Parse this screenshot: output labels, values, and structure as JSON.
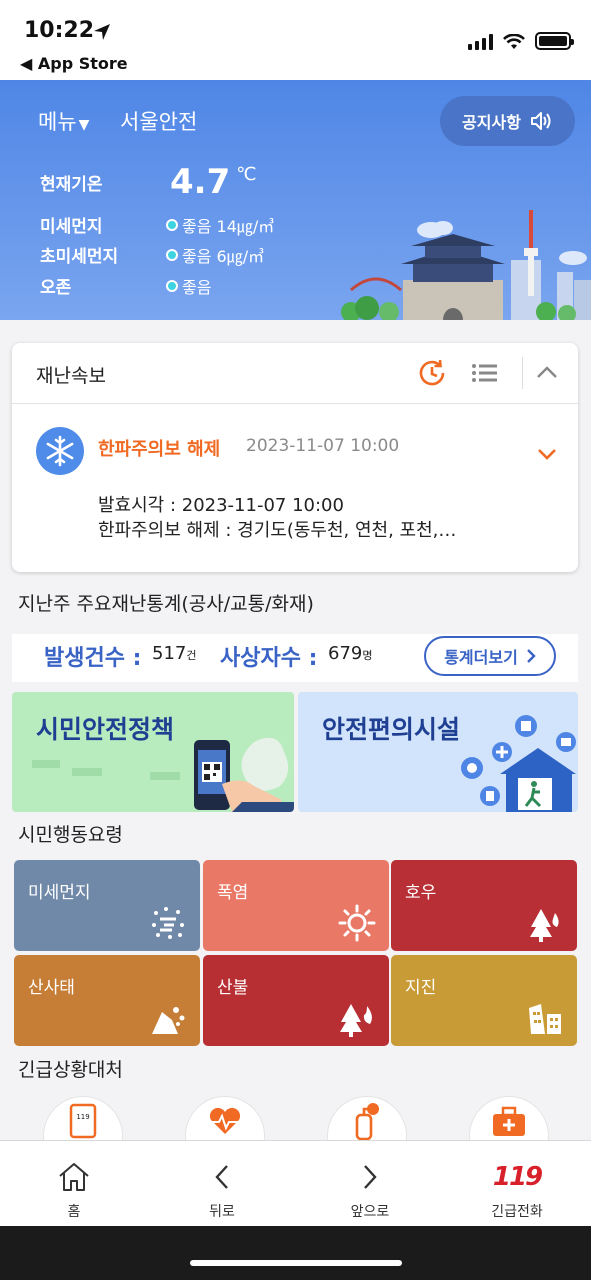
{
  "status_bar": {
    "time": "10:22",
    "back_app": "◀ App Store"
  },
  "header": {
    "menu_label": "메뉴",
    "city": "서울안전",
    "notice_label": "공지사항"
  },
  "weather": {
    "temp_label": "현재기온",
    "temp_value": "4.7",
    "temp_unit": "℃",
    "rows": [
      {
        "label": "미세먼지",
        "value": "좋음 14㎍/㎥"
      },
      {
        "label": "초미세먼지",
        "value": "좋음 6㎍/㎥"
      },
      {
        "label": "오존",
        "value": "좋음"
      }
    ]
  },
  "disaster_card": {
    "title": "재난속보",
    "alert_title": "한파주의보 해제",
    "alert_datetime": "2023-11-07 10:00",
    "body_line1": "발효시각 : 2023-11-07 10:00",
    "body_line2": "한파주의보 해제 : 경기도(동두천, 연천, 포천,…"
  },
  "stats_section": {
    "label": "지난주 주요재난통계(공사/교통/화재)",
    "occurrence_label": "발생건수 :",
    "occurrence_value": "517",
    "occurrence_unit": "건",
    "casualty_label": "사상자수 :",
    "casualty_value": "679",
    "casualty_unit": "명",
    "more_label": "통계더보기"
  },
  "banners": {
    "policy": "시민안전정책",
    "facility": "안전편의시설"
  },
  "guide": {
    "label": "시민행동요령",
    "tiles": [
      {
        "label": "미세먼지",
        "color": "#7189a8",
        "icon": "fine-dust-icon"
      },
      {
        "label": "폭염",
        "color": "#e97966",
        "icon": "sun-icon"
      },
      {
        "label": "호우",
        "color": "#b83035",
        "icon": "heavy-rain-icon"
      },
      {
        "label": "산사태",
        "color": "#c67d35",
        "icon": "landslide-icon"
      },
      {
        "label": "산불",
        "color": "#b82f33",
        "icon": "forest-fire-icon"
      },
      {
        "label": "지진",
        "color": "#c99b36",
        "icon": "earthquake-icon"
      }
    ]
  },
  "emergency": {
    "label": "긴급상황대처",
    "phone_number": "119"
  },
  "tabbar": {
    "home": "홈",
    "back": "뒤로",
    "forward": "앞으로",
    "emergency_call": "긴급전화",
    "emergency_logo": "119"
  }
}
